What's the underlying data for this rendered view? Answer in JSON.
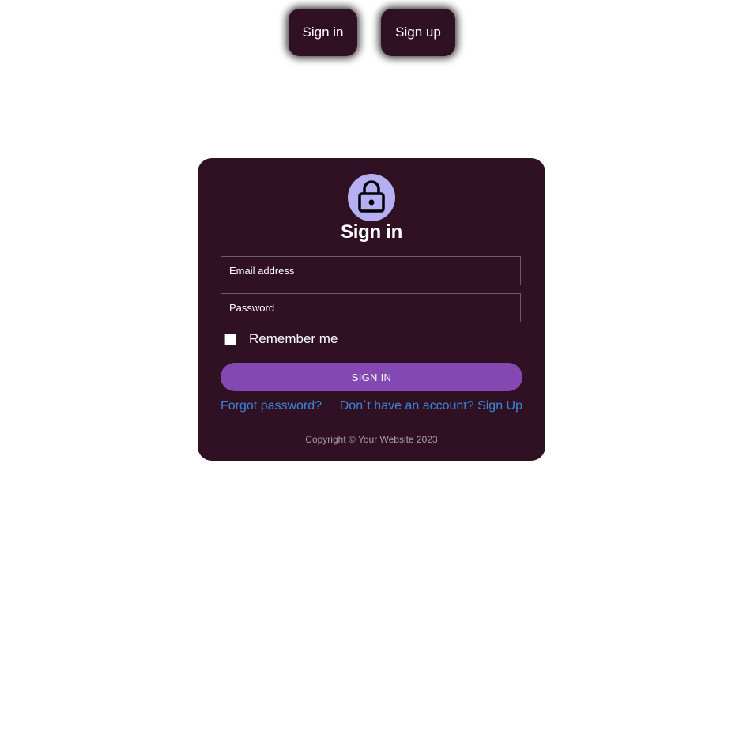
{
  "nav": {
    "sign_in_label": "Sign in",
    "sign_up_label": "Sign up"
  },
  "form": {
    "icon": "lock-icon",
    "title": "Sign in",
    "email_placeholder": "Email address",
    "email_value": "",
    "password_placeholder": "Password",
    "password_value": "",
    "remember_label": "Remember me",
    "remember_checked": false,
    "submit_label": "SIGN IN",
    "forgot_label": "Forgot password?",
    "signup_link_label": "Don`t have an account? Sign Up",
    "copyright": "Copyright © Your Website 2023"
  },
  "colors": {
    "card_bg": "#2f1123",
    "avatar_bg": "#b5b0f3",
    "submit_bg": "#8348b1",
    "link": "#3a86d8"
  }
}
